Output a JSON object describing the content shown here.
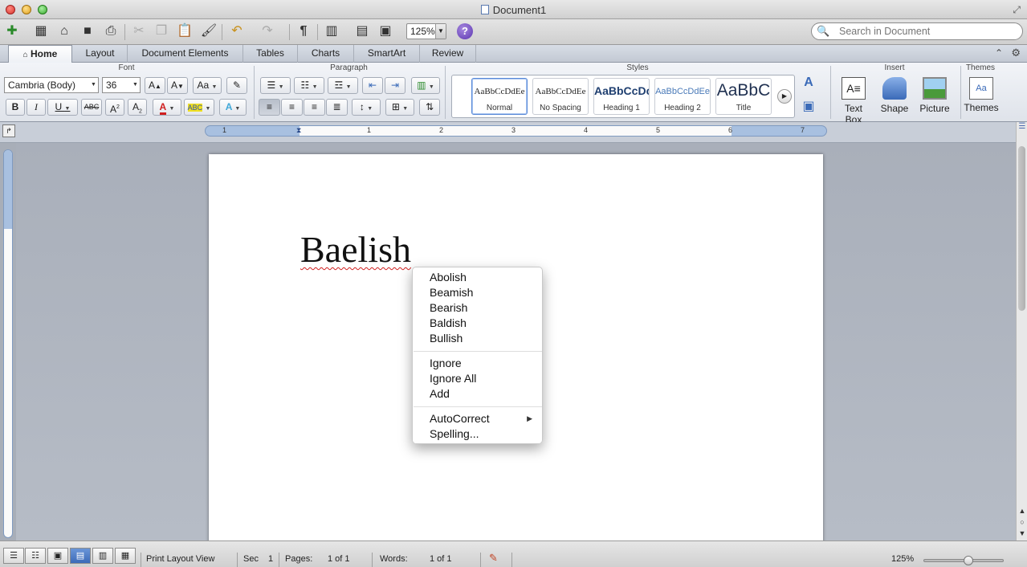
{
  "window": {
    "title": "Document1"
  },
  "toolbar": {
    "zoom": "125%",
    "search_placeholder": "Search in Document"
  },
  "ribbon_tabs": [
    "Home",
    "Layout",
    "Document Elements",
    "Tables",
    "Charts",
    "SmartArt",
    "Review"
  ],
  "ribbon": {
    "groups": {
      "font": "Font",
      "paragraph": "Paragraph",
      "styles": "Styles",
      "insert": "Insert",
      "themes": "Themes"
    },
    "font_name": "Cambria (Body)",
    "font_size": "36",
    "styles": [
      {
        "sample": "AaBbCcDdEe",
        "name": "Normal"
      },
      {
        "sample": "AaBbCcDdEe",
        "name": "No Spacing"
      },
      {
        "sample": "AaBbCcDc",
        "name": "Heading 1"
      },
      {
        "sample": "AaBbCcDdEe",
        "name": "Heading 2"
      },
      {
        "sample": "AaBbC",
        "name": "Title"
      }
    ],
    "insert": {
      "text_box": "Text Box",
      "shape": "Shape",
      "picture": "Picture"
    },
    "themes": {
      "themes": "Themes"
    }
  },
  "ruler": {
    "marks": [
      "1",
      "1",
      "2",
      "3",
      "4",
      "5",
      "6",
      "7"
    ]
  },
  "document": {
    "word": "Baelish"
  },
  "context_menu": {
    "suggestions": [
      "Abolish",
      "Beamish",
      "Bearish",
      "Baldish",
      "Bullish"
    ],
    "actions": [
      "Ignore",
      "Ignore All",
      "Add"
    ],
    "autocorrect": "AutoCorrect",
    "spelling": "Spelling..."
  },
  "statusbar": {
    "view": "Print Layout View",
    "sec_label": "Sec",
    "sec_value": "1",
    "pages_label": "Pages:",
    "pages_value": "1 of 1",
    "words_label": "Words:",
    "words_value": "1 of 1",
    "zoom": "125%"
  },
  "colors": {
    "font_color": "#d02020",
    "highlight_color": "#f0e020",
    "accent": "#3c6ab8"
  }
}
